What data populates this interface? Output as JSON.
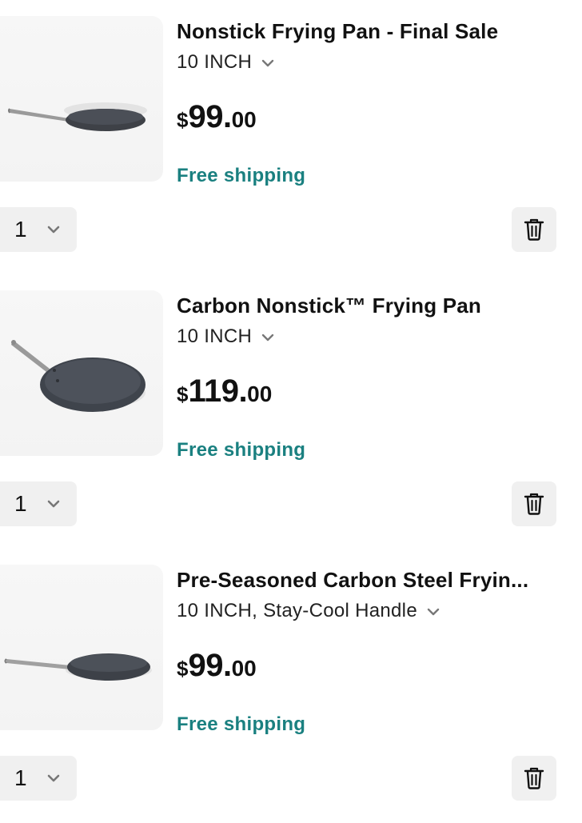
{
  "cart": {
    "items": [
      {
        "title": "Nonstick Frying Pan - Final Sale",
        "variant": "10 INCH",
        "price": {
          "currency": "$",
          "whole": "99.",
          "cents": "00"
        },
        "shipping": "Free shipping",
        "quantity": "1"
      },
      {
        "title": "Carbon Nonstick™ Frying Pan",
        "variant": "10 INCH",
        "price": {
          "currency": "$",
          "whole": "119.",
          "cents": "00"
        },
        "shipping": "Free shipping",
        "quantity": "1"
      },
      {
        "title": "Pre-Seasoned Carbon Steel Fryin...",
        "variant": "10 INCH, Stay-Cool Handle",
        "price": {
          "currency": "$",
          "whole": "99.",
          "cents": "00"
        },
        "shipping": "Free shipping",
        "quantity": "1"
      }
    ]
  },
  "colors": {
    "shipping_text": "#1a8080",
    "control_background": "#f0f0f0",
    "chevron": "#777777"
  },
  "icons": {
    "variant_dropdown": "chevron-down-icon",
    "quantity_dropdown": "chevron-down-icon",
    "remove": "trash-icon",
    "product_image": "frying-pan-image"
  }
}
